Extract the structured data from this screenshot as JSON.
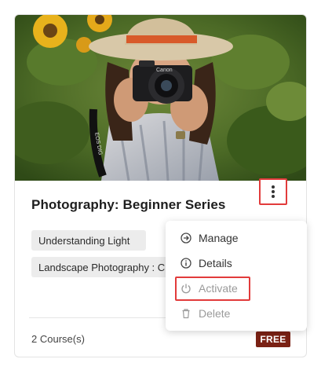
{
  "course": {
    "title": "Photography: Beginner Series",
    "tags": [
      "Understanding Light",
      "Landscape Photography : C"
    ],
    "count_label": "2 Course(s)",
    "price_badge": "FREE",
    "image_alt": "Woman with hat holding a camera in a field of sunflowers",
    "camera_brand": "Canon",
    "strap_text": "EOS DIG"
  },
  "menu": {
    "items": [
      {
        "label": "Manage",
        "icon": "arrow-right-circle-icon",
        "enabled": true
      },
      {
        "label": "Details",
        "icon": "info-circle-icon",
        "enabled": true
      },
      {
        "label": "Activate",
        "icon": "power-icon",
        "enabled": false
      },
      {
        "label": "Delete",
        "icon": "trash-icon",
        "enabled": false
      }
    ]
  },
  "colors": {
    "highlight": "#e23b3b",
    "badge": "#7a2114",
    "tag_bg": "#ececec"
  }
}
